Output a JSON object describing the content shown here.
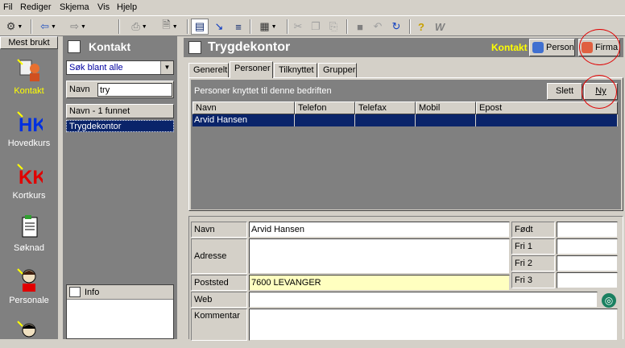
{
  "menu": [
    "Fil",
    "Rediger",
    "Skjema",
    "Vis",
    "Hjelp"
  ],
  "toolbar_icons": [
    "app-menu-icon",
    "back-arrow-icon",
    "forward-arrow-icon",
    "print-icon",
    "copy-doc-icon",
    "form-view-icon",
    "sort-down-icon",
    "filter-icon",
    "table-view-icon",
    "cut-icon",
    "copy-icon",
    "paste-icon",
    "stop-icon",
    "undo-icon",
    "refresh-icon",
    "help-icon",
    "whats-this-icon"
  ],
  "sidebar": {
    "header": "Mest brukt",
    "items": [
      {
        "label": "Kontakt",
        "icon": "contact-icon",
        "active": true
      },
      {
        "label": "Hovedkurs",
        "icon": "hk-icon",
        "active": false
      },
      {
        "label": "Kortkurs",
        "icon": "kk-icon",
        "active": false
      },
      {
        "label": "Søknad",
        "icon": "application-icon",
        "active": false
      },
      {
        "label": "Personale",
        "icon": "staff-icon",
        "active": false
      },
      {
        "label": "",
        "icon": "person-icon",
        "active": false
      }
    ]
  },
  "contact_panel": {
    "title": "Kontakt",
    "search_scope": "Søk blant alle",
    "navn_label": "Navn",
    "navn_value": "try",
    "result_header": "Navn - 1 funnet",
    "results": [
      "Trygdekontor"
    ],
    "info_label": "Info"
  },
  "main": {
    "title": "Trygdekontor",
    "context_label": "Kontakt",
    "person_button": "Person",
    "firma_button": "Firma",
    "tabs": [
      "Generelt",
      "Personer",
      "Tilknyttet",
      "Grupper"
    ],
    "selected_tab": "Personer",
    "grid_caption": "Personer knyttet til denne bedriften",
    "slett_button": "Slett",
    "ny_button": "Ny",
    "columns": [
      "Navn",
      "Telefon",
      "Telefax",
      "Mobil",
      "Epost"
    ],
    "rows": [
      [
        "Arvid Hansen",
        "",
        "",
        "",
        ""
      ]
    ]
  },
  "form": {
    "navn_label": "Navn",
    "navn_value": "Arvid Hansen",
    "adresse_label": "Adresse",
    "adresse_value": "",
    "poststed_label": "Poststed",
    "poststed_value": "7600 LEVANGER",
    "web_label": "Web",
    "web_value": "",
    "kommentar_label": "Kommentar",
    "kommentar_value": "",
    "fodt_label": "Født",
    "fodt_value": "",
    "fri1_label": "Fri 1",
    "fri1_value": "",
    "fri2_label": "Fri 2",
    "fri2_value": "",
    "fri3_label": "Fri 3",
    "fri3_value": ""
  },
  "colors": {
    "selection": "#0a246a",
    "highlight_circle": "#e00000",
    "active_label": "#ffff00",
    "poststed_bg": "#ffffc0"
  }
}
